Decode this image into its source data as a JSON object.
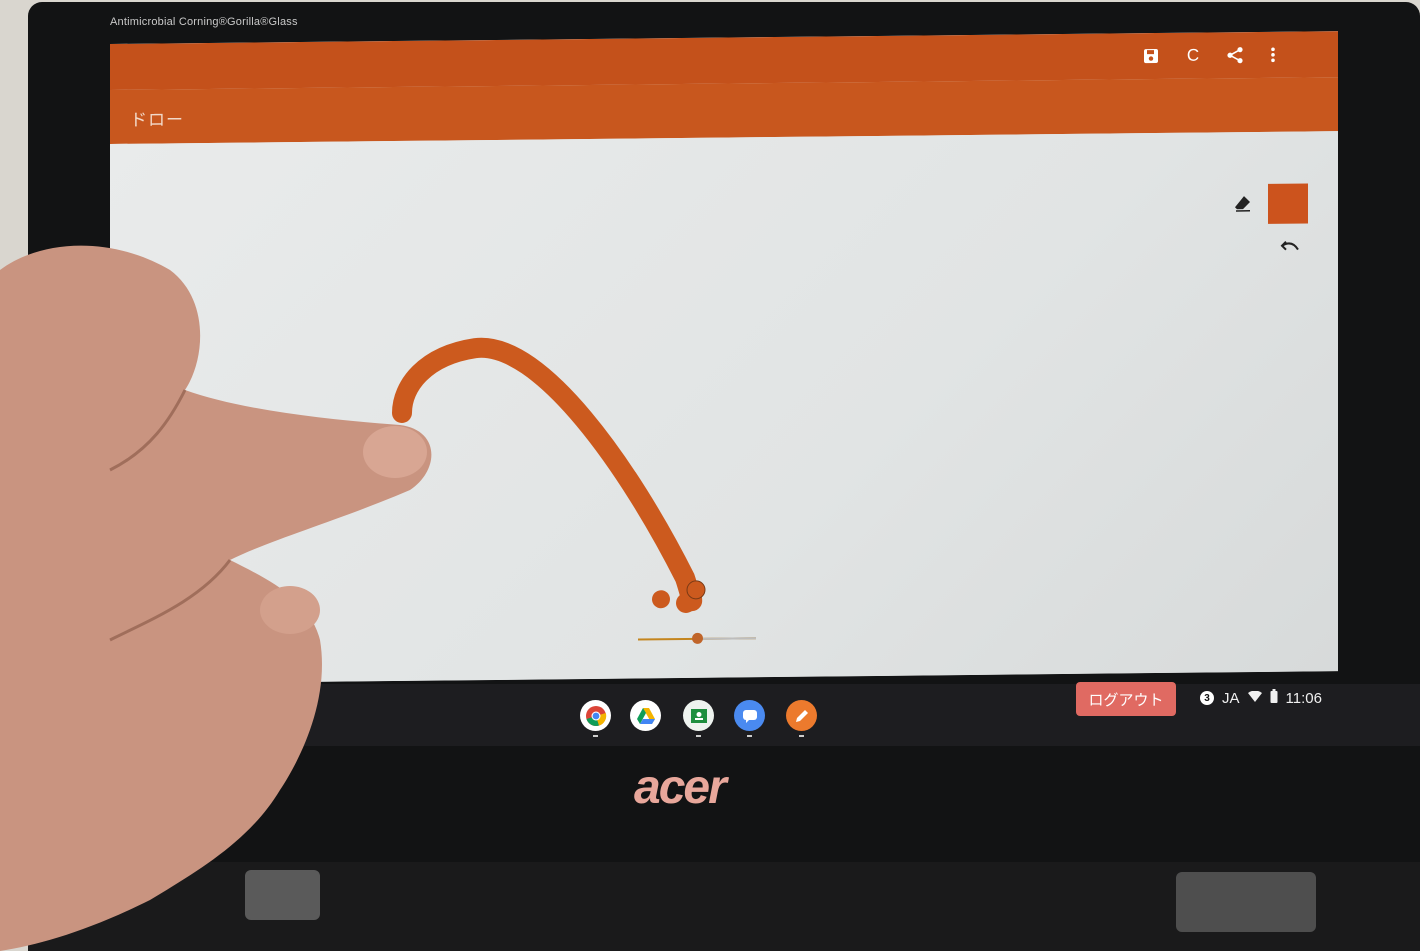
{
  "device": {
    "bezel_text": "Antimicrobial Corning®Gorilla®Glass",
    "brand": "acer"
  },
  "app": {
    "title": "ドロー",
    "toolbar": {
      "save_icon": "save-icon",
      "clear_label": "C",
      "share_icon": "share-icon",
      "more_icon": "more-vert-icon"
    },
    "tools": {
      "eraser_icon": "eraser-icon",
      "undo_icon": "undo-icon",
      "color": "#cc531d"
    },
    "brush_size_fraction": 0.5
  },
  "shelf": {
    "apps": [
      {
        "name": "chrome",
        "icon": "chrome-icon"
      },
      {
        "name": "drive",
        "icon": "drive-icon"
      },
      {
        "name": "classroom",
        "icon": "classroom-icon"
      },
      {
        "name": "messages",
        "icon": "messages-icon"
      },
      {
        "name": "draw",
        "icon": "pencil-icon"
      }
    ],
    "logout_label": "ログアウト",
    "notification_count": "3",
    "ime": "JA",
    "time": "11:06"
  },
  "colors": {
    "accent": "#c8571e",
    "stroke": "#cc5a1e",
    "logout": "#e06a62"
  }
}
